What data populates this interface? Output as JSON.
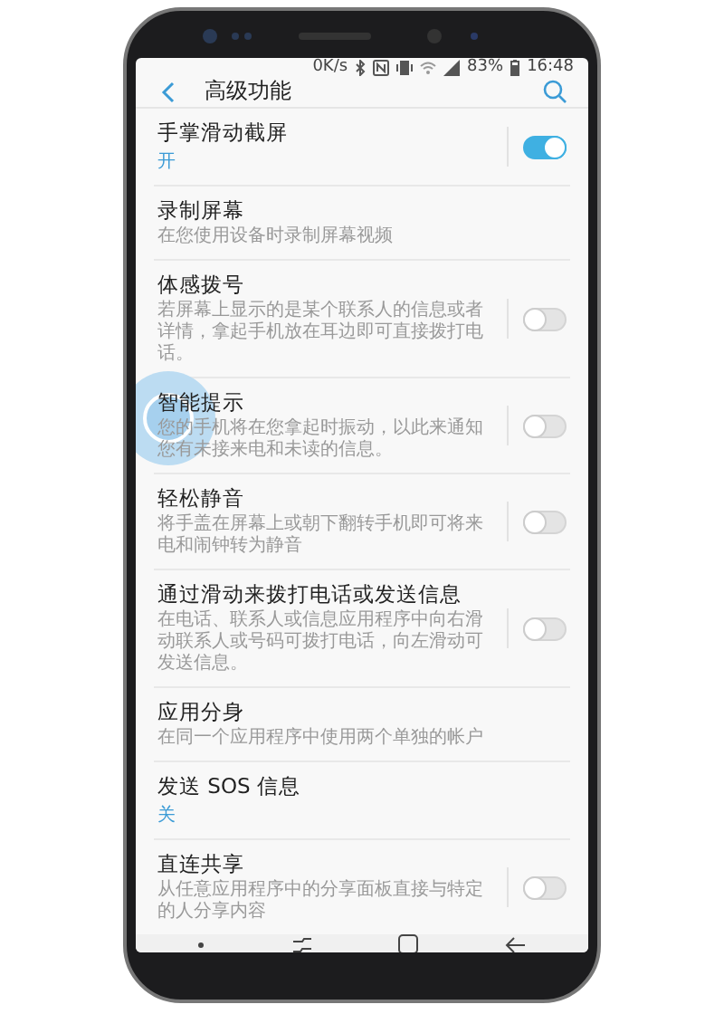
{
  "status_bar": {
    "speed": "0K/s",
    "battery": "83%",
    "time": "16:48"
  },
  "header": {
    "title": "高级功能"
  },
  "items": [
    {
      "kind": "toggle",
      "title": "手掌滑动截屏",
      "status": "开",
      "on": true
    },
    {
      "kind": "plain",
      "title": "录制屏幕",
      "description": "在您使用设备时录制屏幕视频"
    },
    {
      "kind": "toggle",
      "title": "体感拨号",
      "description": "若屏幕上显示的是某个联系人的信息或者详情，拿起手机放在耳边即可直接拨打电话。",
      "on": false
    },
    {
      "kind": "toggle",
      "title": "智能提示",
      "description": "您的手机将在您拿起时振动，以此来通知您有未接来电和未读的信息。",
      "on": false,
      "touched": true
    },
    {
      "kind": "toggle",
      "title": "轻松静音",
      "description": "将手盖在屏幕上或朝下翻转手机即可将来电和闹钟转为静音",
      "on": false
    },
    {
      "kind": "toggle",
      "title": "通过滑动来拨打电话或发送信息",
      "description": "在电话、联系人或信息应用程序中向右滑动联系人或号码可拨打电话，向左滑动可发送信息。",
      "on": false
    },
    {
      "kind": "plain",
      "title": "应用分身",
      "description": "在同一个应用程序中使用两个单独的帐户"
    },
    {
      "kind": "plain",
      "title": "发送 SOS 信息",
      "status": "关"
    },
    {
      "kind": "toggle",
      "title": "直连共享",
      "description": "从任意应用程序中的分享面板直接与特定的人分享内容",
      "on": false
    }
  ]
}
